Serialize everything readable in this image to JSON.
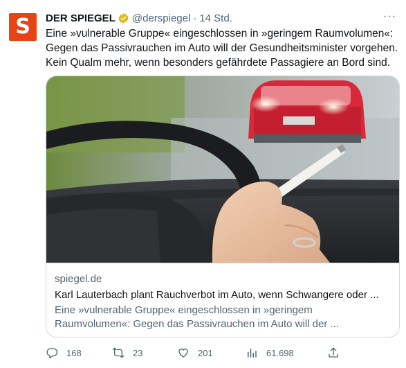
{
  "tweet": {
    "avatar_letter": "S",
    "author_name": "DER SPIEGEL",
    "handle": "@derspiegel",
    "separator": "·",
    "time": "14 Std.",
    "more": "···",
    "text": "Eine »vulnerable Gruppe« eingeschlossen in »geringem Raumvolumen«: Gegen das Passivrauchen im Auto will der Gesundheitsminister vorgehen. Kein Qualm mehr, wenn besonders gefährdete Passagiere an Bord sind.",
    "card": {
      "domain": "spiegel.de",
      "title": "Karl Lauterbach plant Rauchverbot im Auto, wenn Schwangere oder ...",
      "description": "Eine »vulnerable Gruppe« eingeschlossen in »geringem Raumvolumen«: Gegen das Passivrauchen im Auto will der ..."
    },
    "actions": {
      "replies": "168",
      "retweets": "23",
      "likes": "201",
      "views": "61.698"
    }
  },
  "colors": {
    "brand": "#e64415",
    "verified_gold": "#e2b719",
    "text_primary": "#0f1419",
    "text_secondary": "#536471",
    "border": "#cfd9de"
  },
  "icons": [
    "reply-icon",
    "retweet-icon",
    "like-icon",
    "views-icon",
    "share-icon",
    "verified-badge-icon",
    "more-icon"
  ]
}
